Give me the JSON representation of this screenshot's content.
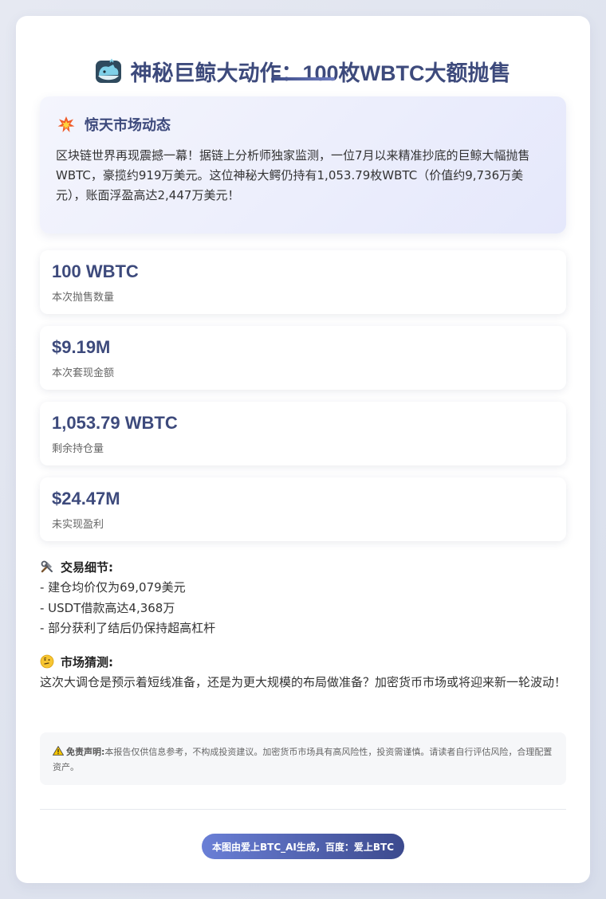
{
  "header": {
    "icon": "whale-icon",
    "title": "神秘巨鲸大动作：100枚WBTC大额抛售"
  },
  "alert": {
    "icon": "collision-icon",
    "title": "惊天市场动态",
    "text": "区块链世界再现震撼一幕！据链上分析师独家监测，一位7月以来精准抄底的巨鲸大幅抛售WBTC，豪揽约919万美元。这位神秘大鳄仍持有1,053.79枚WBTC（价值约9,736万美元），账面浮盈高达2,447万美元！"
  },
  "stats": [
    {
      "value": "100 WBTC",
      "label": "本次抛售数量"
    },
    {
      "value": "$9.19M",
      "label": "本次套现金额"
    },
    {
      "value": "1,053.79 WBTC",
      "label": "剩余持仓量"
    },
    {
      "value": "$24.47M",
      "label": "未实现盈利"
    }
  ],
  "details": {
    "icon": "tools-icon",
    "title": "交易细节:",
    "lines": [
      "- 建仓均价仅为69,079美元",
      "- USDT借款高达4,368万",
      "- 部分获利了结后仍保持超高杠杆"
    ]
  },
  "speculation": {
    "icon": "thinking-face-icon",
    "title": "市场猜测:",
    "text": "这次大调仓是预示着短线准备，还是为更大规模的布局做准备？加密货币市场或将迎来新一轮波动！"
  },
  "disclaimer": {
    "icon": "warning-icon",
    "label": "免责声明:",
    "text": "本报告仅供信息参考，不构成投资建议。加密货币市场具有高风险性，投资需谨慎。请读者自行评估风险，合理配置资产。"
  },
  "footer": {
    "badge": "本图由爱上BTC_AI生成，百度：爱上BTC"
  },
  "colors": {
    "accent": "#3d4a7c",
    "badge_start": "#6a7fd6",
    "badge_end": "#3c4a8e"
  }
}
